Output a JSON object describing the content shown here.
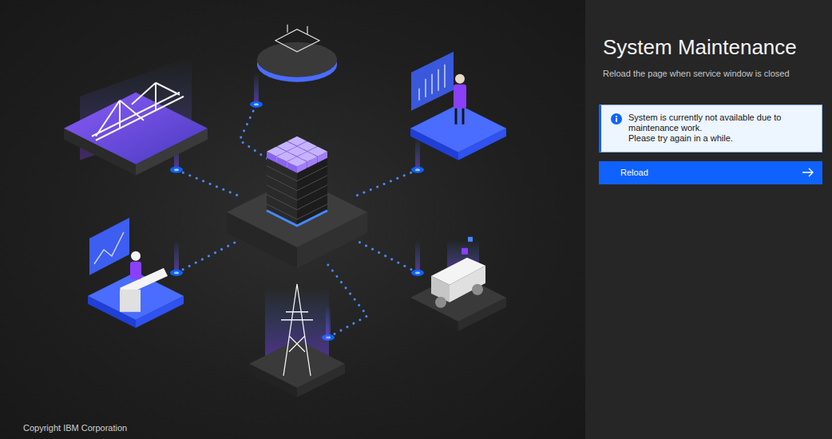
{
  "page": {
    "title": "System Maintenance",
    "subtitle": "Reload the page when service window is closed"
  },
  "notification": {
    "lines": [
      "System is currently not available due to maintenance work.",
      "Please try again in a while."
    ]
  },
  "button": {
    "label": "Reload"
  },
  "footer": {
    "copyright": "Copyright IBM Corporation"
  }
}
